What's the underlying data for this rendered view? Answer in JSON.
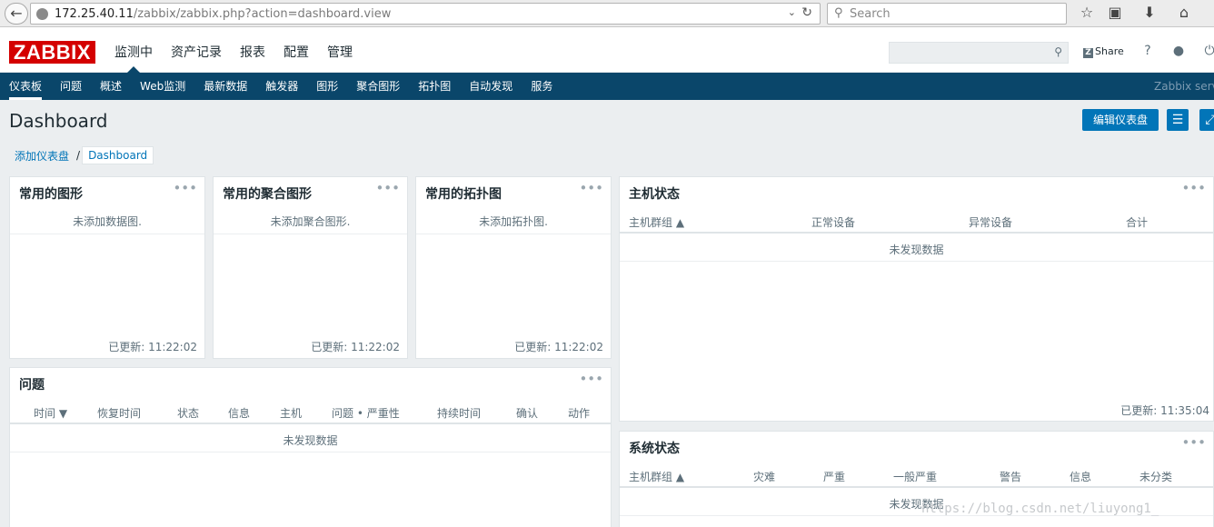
{
  "browser": {
    "url_host": "172.25.40.11",
    "url_path": "/zabbix/zabbix.php?action=dashboard.view",
    "search_placeholder": "Search"
  },
  "header": {
    "logo": "ZABBIX",
    "nav": [
      "监测中",
      "资产记录",
      "报表",
      "配置",
      "管理"
    ],
    "share_label": "Share",
    "help_glyph": "?"
  },
  "subnav": {
    "items": [
      "仪表板",
      "问题",
      "概述",
      "Web监测",
      "最新数据",
      "触发器",
      "图形",
      "聚合图形",
      "拓扑图",
      "自动发现",
      "服务"
    ],
    "server_name": "Zabbix serve"
  },
  "page": {
    "title": "Dashboard",
    "edit_button": "编辑仪表盘",
    "breadcrumb_parent": "添加仪表盘",
    "breadcrumb_sep": "/",
    "breadcrumb_current": "Dashboard"
  },
  "widgets": {
    "fav_graphs": {
      "title": "常用的图形",
      "empty": "未添加数据图.",
      "updated": "已更新: 11:22:02"
    },
    "fav_screens": {
      "title": "常用的聚合图形",
      "empty": "未添加聚合图形.",
      "updated": "已更新: 11:22:02"
    },
    "fav_maps": {
      "title": "常用的拓扑图",
      "empty": "未添加拓扑图.",
      "updated": "已更新: 11:22:02"
    },
    "host_status": {
      "title": "主机状态",
      "columns": [
        "主机群组 ▲",
        "正常设备",
        "异常设备",
        "合计"
      ],
      "empty": "未发现数据",
      "updated": "已更新: 11:35:04"
    },
    "problems": {
      "title": "问题",
      "columns": [
        "时间 ▼",
        "恢复时间",
        "状态",
        "信息",
        "主机",
        "问题 • 严重性",
        "持续时间",
        "确认",
        "动作"
      ],
      "empty": "未发现数据"
    },
    "system_status": {
      "title": "系统状态",
      "columns": [
        "主机群组 ▲",
        "灾难",
        "严重",
        "一般严重",
        "警告",
        "信息",
        "未分类"
      ],
      "empty": "未发现数据"
    }
  },
  "watermark": "https://blog.csdn.net/liuyong1_",
  "colors": {
    "brand": "#d40000",
    "nav_bg": "#0a466a",
    "button": "#0275b8",
    "page_bg": "#ebeef0"
  },
  "icons": [
    "back-arrow-icon",
    "globe-icon",
    "reload-icon",
    "star-icon",
    "clipboard-icon",
    "download-icon",
    "home-icon",
    "search-icon",
    "share-icon",
    "help-icon",
    "user-icon",
    "power-icon",
    "menu-icon",
    "fullscreen-icon",
    "more-dots-icon"
  ]
}
